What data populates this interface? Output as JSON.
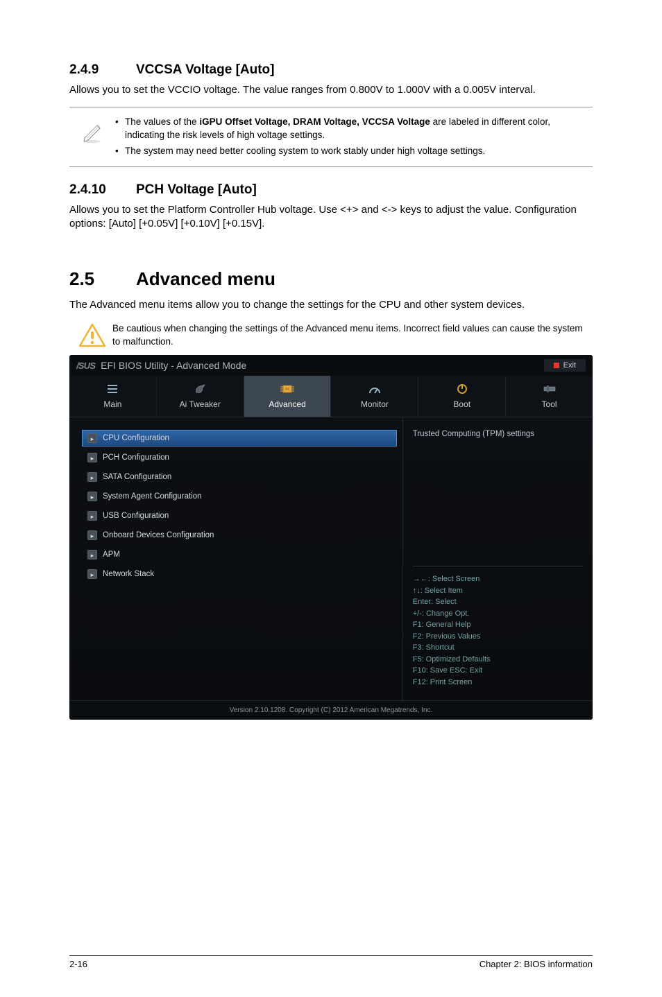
{
  "sect249": {
    "num": "2.4.9",
    "title": "VCCSA Voltage [Auto]",
    "body": "Allows you to set the VCCIO voltage. The value ranges from 0.800V to 1.000V with a 0.005V interval."
  },
  "note": {
    "bullets": [
      {
        "pre": "The values of the ",
        "bold": "iGPU Offset Voltage, DRAM Voltage, VCCSA Voltage",
        "post": " are labeled in different color, indicating the risk levels of high voltage settings."
      },
      {
        "pre": "The system may need better cooling system to work stably under high voltage settings.",
        "bold": "",
        "post": ""
      }
    ]
  },
  "sect2410": {
    "num": "2.4.10",
    "title": "PCH Voltage [Auto]",
    "body": "Allows you to set the Platform Controller Hub voltage. Use <+> and <-> keys to adjust the value. Configuration options: [Auto] [+0.05V] [+0.10V] [+0.15V]."
  },
  "chap25": {
    "num": "2.5",
    "title": "Advanced menu",
    "body": "The Advanced menu items allow you to change the settings for the CPU and other system devices."
  },
  "caution": "Be cautious when changing the settings of the Advanced menu items. Incorrect field values can cause the system to malfunction.",
  "bios": {
    "brand": "/SUS",
    "title": "EFI BIOS Utility - Advanced Mode",
    "exit": "Exit",
    "tabs": [
      "Main",
      "Ai Tweaker",
      "Advanced",
      "Monitor",
      "Boot",
      "Tool"
    ],
    "activeTab": 2,
    "items": [
      "CPU Configuration",
      "PCH Configuration",
      "SATA Configuration",
      "System Agent Configuration",
      "USB Configuration",
      "Onboard Devices Configuration",
      "APM",
      "Network Stack"
    ],
    "selectedItem": 0,
    "infoTop": "Trusted Computing (TPM) settings",
    "keys": [
      "→←: Select Screen",
      "↑↓: Select Item",
      "Enter: Select",
      "+/-: Change Opt.",
      "F1: General Help",
      "F2: Previous Values",
      "F3: Shortcut",
      "F5: Optimized Defaults",
      "F10: Save   ESC: Exit",
      "F12: Print Screen"
    ],
    "footer": "Version 2.10.1208.  Copyright (C) 2012 American Megatrends, Inc."
  },
  "footer": {
    "left": "2-16",
    "right": "Chapter 2: BIOS information"
  }
}
